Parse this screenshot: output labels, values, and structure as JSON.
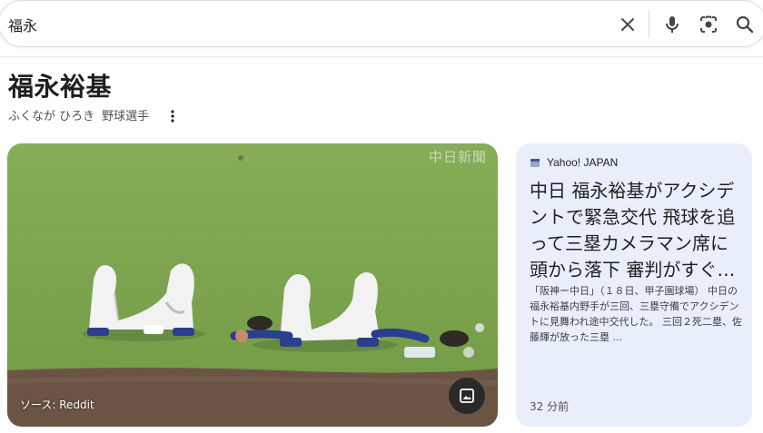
{
  "search": {
    "query": "福永",
    "clear_icon": "close-icon",
    "voice_icon": "mic-icon",
    "lens_icon": "camera-lens-icon",
    "search_icon": "search-icon"
  },
  "entity": {
    "title": "福永裕基",
    "reading": "ふくなが ひろき",
    "category": "野球選手",
    "more_icon": "more-vert-icon"
  },
  "image_card": {
    "watermark": "中日新聞",
    "source_label": "ソース: Reddit",
    "action_icon": "image-icon"
  },
  "news_card": {
    "source": "Yahoo! JAPAN",
    "headline": "中日 福永裕基がアクシデントで緊急交代 飛球を追って三塁カメラマン席に頭から落下 審判がすぐ…",
    "snippet": "「阪神ー中日」（１８日、甲子園球場） 中日の福永裕基内野手が三回、三塁守備でアクシデントに見舞われ途中交代した。 三回２死二塁、佐藤輝が放った三塁 ...",
    "time": "32 分前"
  },
  "colors": {
    "news_card_bg": "#e9eefb",
    "grass": "#7fa552",
    "dirt": "#6b5444"
  }
}
